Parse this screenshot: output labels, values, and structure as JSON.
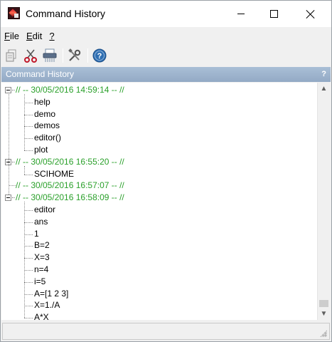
{
  "window": {
    "title": "Command History",
    "icon": "scilab-app-icon",
    "controls": [
      "minimize-icon",
      "maximize-icon",
      "close-icon"
    ]
  },
  "menu": {
    "items": [
      {
        "label": "File",
        "mnemonic": "F",
        "rest": "ile"
      },
      {
        "label": "Edit",
        "mnemonic": "E",
        "rest": "dit"
      },
      {
        "label": "?",
        "mnemonic": "?",
        "rest": ""
      }
    ]
  },
  "toolbar": {
    "buttons": [
      "copy-icon",
      "cut-icon",
      "clear-history-icon",
      "preferences-icon",
      "help-icon"
    ]
  },
  "panel": {
    "title": "Command History",
    "help_mark": "?"
  },
  "history": {
    "sessions": [
      {
        "label": "// -- 30/05/2016 14:59:14 -- //",
        "commands": [
          "help",
          "demo",
          "demos",
          "editor()",
          "plot"
        ]
      },
      {
        "label": "// -- 30/05/2016 16:55:20 -- //",
        "commands": [
          "SCIHOME"
        ]
      },
      {
        "label": "// -- 30/05/2016 16:57:07 -- //",
        "commands": []
      },
      {
        "label": "// -- 30/05/2016 16:58:09 -- //",
        "commands": [
          "editor",
          "ans",
          "1",
          "B=2",
          "X=3",
          "n=4",
          "i=5",
          "A=[1 2 3]",
          "X=1./A",
          "A*X"
        ]
      }
    ]
  },
  "colors": {
    "session_text": "#2aa02a",
    "panel_header": "#9fb5ce",
    "tree_lines": "#8a8a8a"
  },
  "statusbar": {
    "text": ""
  }
}
